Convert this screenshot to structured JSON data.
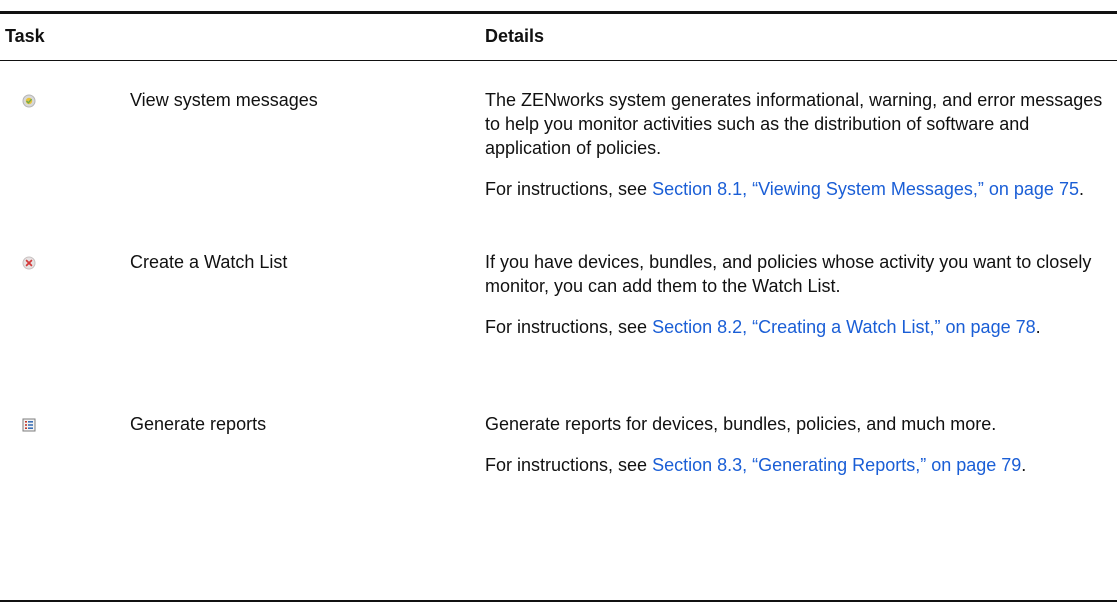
{
  "header": {
    "task": "Task",
    "details": "Details"
  },
  "rows": [
    {
      "icon": "system-messages-icon",
      "task": "View system messages",
      "description": "The ZENworks system generates informational, warning, and error messages to help you monitor activities such as the distribution of software and application of policies.",
      "instructions_prefix": "For instructions, see ",
      "link_text": "Section 8.1, “Viewing System Messages,” on page 75",
      "instructions_suffix": "."
    },
    {
      "icon": "watch-list-icon",
      "task": "Create a Watch List",
      "description": "If you have devices, bundles, and policies whose activity you want to closely monitor, you can add them to the Watch List.",
      "instructions_prefix": "For instructions, see ",
      "link_text": "Section 8.2, “Creating a Watch List,” on page 78",
      "instructions_suffix": "."
    },
    {
      "icon": "reports-icon",
      "task": "Generate reports",
      "description": "Generate reports for devices, bundles, policies, and much more.",
      "instructions_prefix": "For instructions, see ",
      "link_text": "Section 8.3, “Generating Reports,” on page 79",
      "instructions_suffix": "."
    }
  ],
  "colors": {
    "link": "#1a5ed6",
    "rule": "#111111"
  }
}
